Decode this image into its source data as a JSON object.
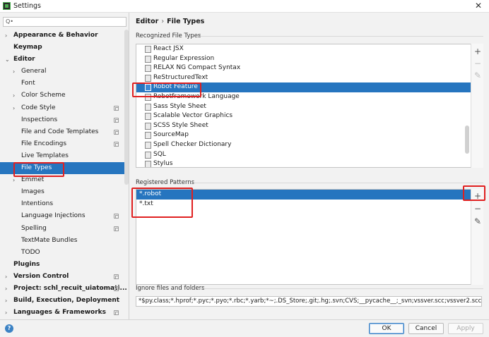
{
  "window": {
    "title": "Settings"
  },
  "sidebar": {
    "search_placeholder": "Q•",
    "items": [
      {
        "label": "Appearance & Behavior"
      },
      {
        "label": "Keymap"
      },
      {
        "label": "Editor"
      },
      {
        "label": "General"
      },
      {
        "label": "Font"
      },
      {
        "label": "Color Scheme"
      },
      {
        "label": "Code Style"
      },
      {
        "label": "Inspections"
      },
      {
        "label": "File and Code Templates"
      },
      {
        "label": "File Encodings"
      },
      {
        "label": "Live Templates"
      },
      {
        "label": "File Types"
      },
      {
        "label": "Emmet"
      },
      {
        "label": "Images"
      },
      {
        "label": "Intentions"
      },
      {
        "label": "Language Injections"
      },
      {
        "label": "Spelling"
      },
      {
        "label": "TextMate Bundles"
      },
      {
        "label": "TODO"
      },
      {
        "label": "Plugins"
      },
      {
        "label": "Version Control"
      },
      {
        "label": "Project: schl_recuit_uiatomati..."
      },
      {
        "label": "Build, Execution, Deployment"
      },
      {
        "label": "Languages & Frameworks"
      }
    ]
  },
  "breadcrumb": {
    "parent": "Editor",
    "separator": "›",
    "current": "File Types"
  },
  "recognized": {
    "label": "Recognized File Types",
    "items": [
      "React JSX",
      "Regular Expression",
      "RELAX NG Compact Syntax",
      "ReStructuredText",
      "Robot Feature",
      "Robotframework Language",
      "Sass Style Sheet",
      "Scalable Vector Graphics",
      "SCSS Style Sheet",
      "SourceMap",
      "Spell Checker Dictionary",
      "SQL",
      "Stylus"
    ],
    "selected": "Robot Feature"
  },
  "patterns": {
    "label": "Registered Patterns",
    "items": [
      "*.robot",
      "*.txt"
    ],
    "selected": "*.robot"
  },
  "ignore": {
    "label": "Ignore files and folders",
    "value": "*$py.class;*.hprof;*.pyc;*.pyo;*.rbc;*.yarb;*~;.DS_Store;.git;.hg;.svn;CVS;__pycache__;_svn;vssver.scc;vssver2.scc;"
  },
  "toolbar": {
    "add": "+",
    "remove": "−",
    "edit": "✎"
  },
  "buttons": {
    "help": "?",
    "ok": "OK",
    "cancel": "Cancel",
    "apply": "Apply"
  },
  "colors": {
    "selection": "#2675bf",
    "highlight_box": "#e02020"
  }
}
